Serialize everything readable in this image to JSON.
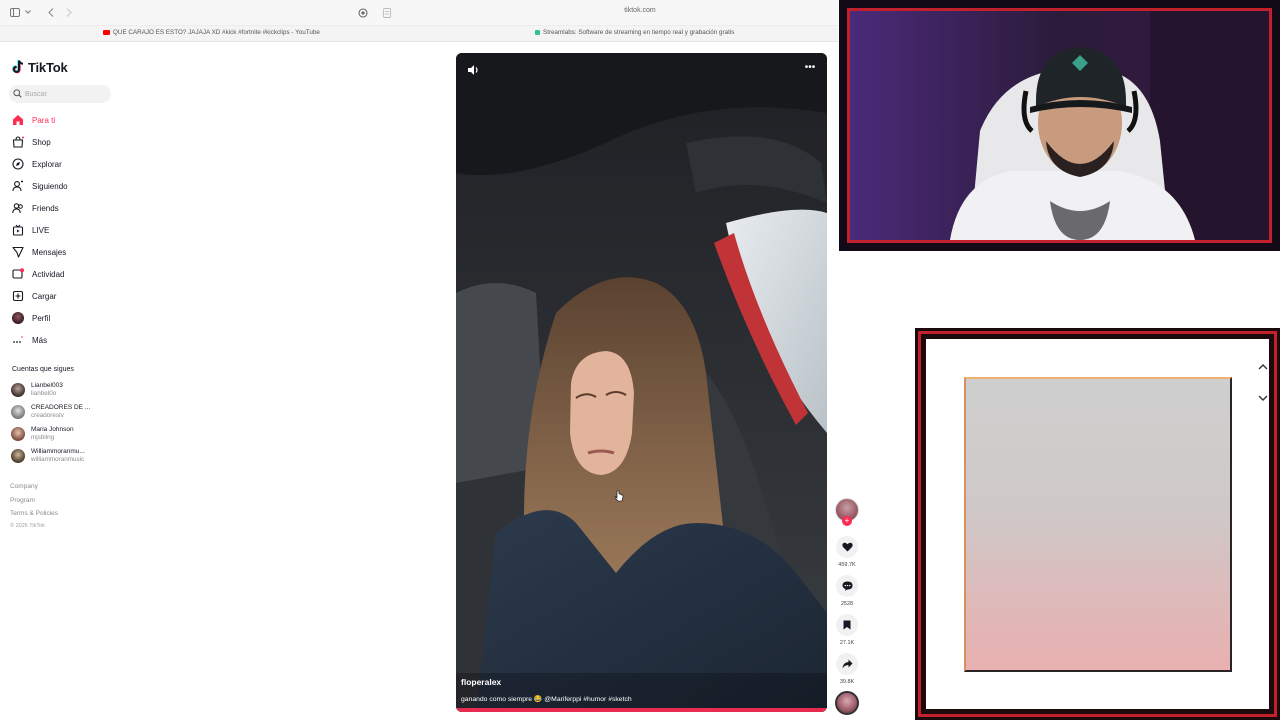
{
  "browser": {
    "url": "tiktok.com",
    "bookmarks": [
      {
        "label": "QUE CARAJO ES ESTO? JAJAJA XD #kick #fortnite #kickclips - YouTube",
        "color": "#ff0000"
      },
      {
        "label": "Streamlabs: Software de streaming en tiempo real y grabación gratis",
        "color": "#31c48d"
      }
    ]
  },
  "sidebar": {
    "logo": "TikTok",
    "search_placeholder": "Buscar",
    "nav": [
      {
        "label": "Para ti",
        "icon": "home-icon",
        "active": true
      },
      {
        "label": "Shop",
        "icon": "shop-icon"
      },
      {
        "label": "Explorar",
        "icon": "compass-icon"
      },
      {
        "label": "Siguiendo",
        "icon": "following-icon"
      },
      {
        "label": "Friends",
        "icon": "friends-icon"
      },
      {
        "label": "LIVE",
        "icon": "live-icon"
      },
      {
        "label": "Mensajes",
        "icon": "messages-icon"
      },
      {
        "label": "Actividad",
        "icon": "activity-icon"
      },
      {
        "label": "Cargar",
        "icon": "upload-icon"
      },
      {
        "label": "Perfil",
        "icon": "profile-avatar"
      },
      {
        "label": "Más",
        "icon": "more-icon"
      }
    ],
    "following_title": "Cuentas que sigues",
    "following": [
      {
        "name": "Lianbel003",
        "handle": "lianbel0o"
      },
      {
        "name": "CREADORES DE ...",
        "handle": "creadorestv"
      },
      {
        "name": "Maria Johnson",
        "handle": "mjsbling"
      },
      {
        "name": "Williammoranmu...",
        "handle": "williammoranmusic"
      }
    ],
    "footer": [
      "Company",
      "Program",
      "Terms & Policies"
    ],
    "copyright": "© 2026 TikTok"
  },
  "video": {
    "author": "floperalex",
    "caption": "ganando como siempre 😂 @Mariferppi #humor #sketch"
  },
  "actions": {
    "likes": "459.7K",
    "comments": "2528",
    "saves": "27.1K",
    "shares": "39.8K"
  },
  "colors": {
    "brand": "#fe2c55",
    "frame_red": "#c2202c"
  }
}
